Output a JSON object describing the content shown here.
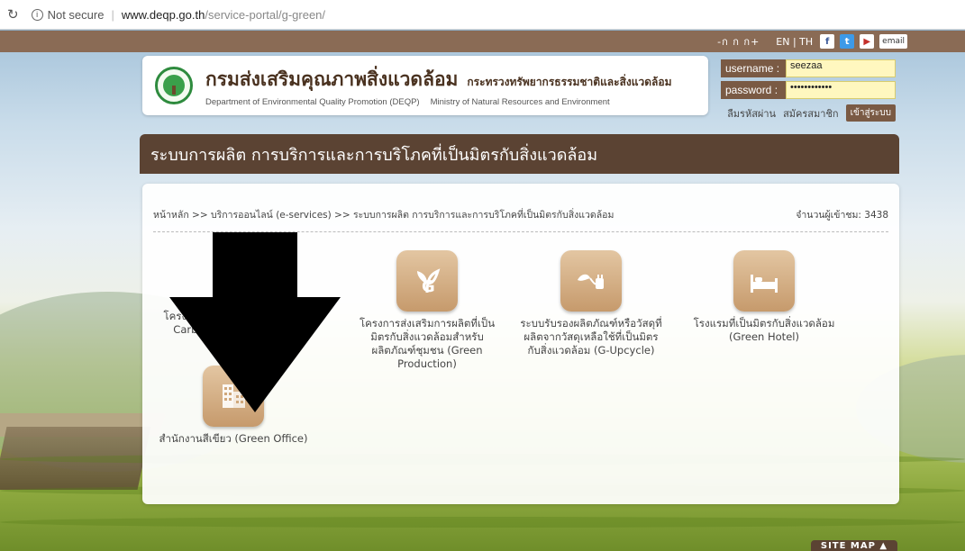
{
  "browser": {
    "security_label": "Not secure",
    "url_host": "www.deqp.go.th",
    "url_path": "/service-portal/g-green/"
  },
  "topbar": {
    "font_size_controls": "-ก ก ก+",
    "lang": "EN | TH",
    "social": {
      "facebook": "f",
      "twitter": "t",
      "youtube": "▶",
      "email": "email"
    }
  },
  "header": {
    "org_th": "กรมส่งเสริมคุณภาพสิ่งแวดล้อม",
    "ministry_th": "กระทรวงทรัพยากรธรรมชาติและสิ่งแวดล้อม",
    "org_en": "Department of Environmental Quality Promotion (DEQP)",
    "ministry_en": "Ministry of Natural Resources and Environment"
  },
  "login": {
    "username_label": "username :",
    "username_value": "seezaa",
    "password_label": "password :",
    "password_value": "••••••••••••",
    "forgot": "ลืมรหัสผ่าน",
    "register": "สมัครสมาชิก",
    "login_button": "เข้าสู่ระบบ"
  },
  "title": "ระบบการผลิต การบริการและการบริโภคที่เป็นมิตรกับสิ่งแวดล้อม",
  "breadcrumb": {
    "text": "หน้าหลัก >> บริการออนไลน์ (e-services) >> ระบบการผลิต การบริการและการบริโภคที่เป็นมิตรกับสิ่งแวดล้อม",
    "visitors": "จำนวนผู้เข้าชม: 3438"
  },
  "tiles": [
    {
      "label": "โครงการ...ตุดพรี นท์ (... Carbon Footprint)",
      "icon": "footprint-icon"
    },
    {
      "label": "โครงการส่งเสริมการผลิตที่เป็นมิตรกับสิ่งแวดล้อมสำหรับผลิตภัณฑ์ชุมชน (Green Production)",
      "icon": "g-leaf-icon"
    },
    {
      "label": "ระบบรับรองผลิตภัณฑ์หรือวัสดุที่ผลิตจากวัสดุเหลือใช้ที่เป็นมิตรกับสิ่งแวดล้อม (G-Upcycle)",
      "icon": "plug-leaf-icon"
    },
    {
      "label": "โรงแรมที่เป็นมิตรกับสิ่งแวดล้อม (Green Hotel)",
      "icon": "bed-icon"
    },
    {
      "label": "สำนักงานสีเขียว (Green Office)",
      "icon": "office-building-icon"
    }
  ],
  "sitemap": "SITE MAP ▲"
}
